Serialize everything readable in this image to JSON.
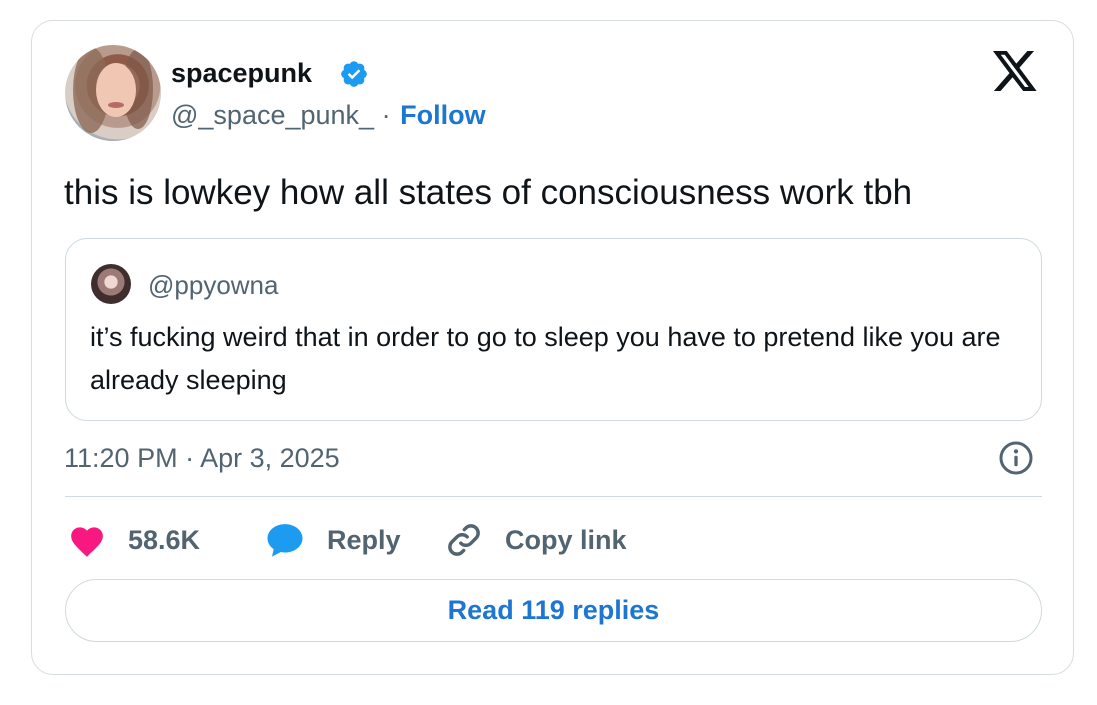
{
  "author": {
    "display_name": "spacepunk",
    "handle": "@_space_punk_",
    "separator": "·",
    "follow_label": "Follow"
  },
  "icons": {
    "verified": "verified-badge-icon",
    "brand": "x-logo-icon",
    "info": "info-icon",
    "like": "heart-icon",
    "reply": "speech-bubble-icon",
    "copy": "link-icon"
  },
  "tweet": {
    "text": "this is lowkey how all states of consciousness work tbh",
    "timestamp": "11:20 PM · Apr 3, 2025"
  },
  "quote": {
    "handle": "@ppyowna",
    "text": "it’s fucking weird that in order to go to sleep you have to pretend like you are already sleeping"
  },
  "actions": {
    "like_count": "58.6K",
    "reply_label": "Reply",
    "copy_label": "Copy link"
  },
  "read_replies_label": "Read 119 replies",
  "colors": {
    "accent": "#1d76d2",
    "like": "#f91880",
    "reply": "#1d9bf0",
    "muted": "#536471",
    "border": "#cfd9de"
  }
}
